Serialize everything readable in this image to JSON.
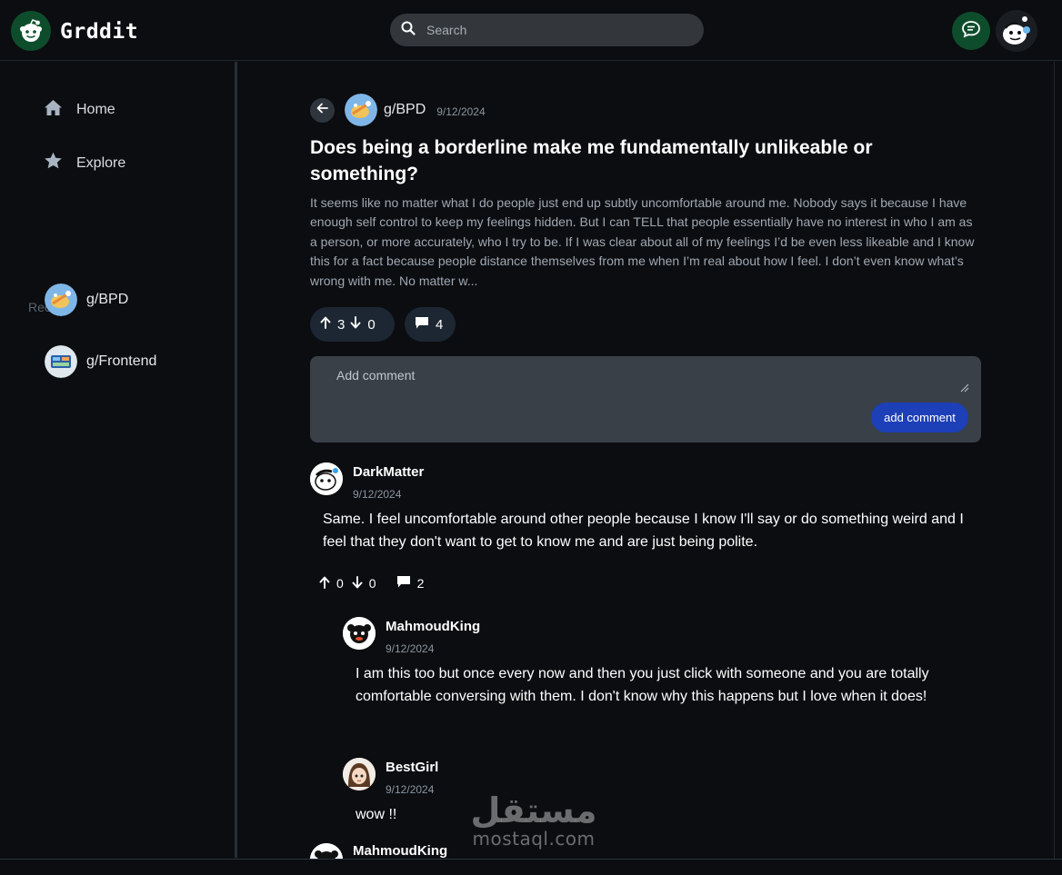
{
  "app": {
    "name": "Grddit",
    "brand_color": "#0e4d2c",
    "accent": "#1d3fb8"
  },
  "search": {
    "placeholder": "Search"
  },
  "sidebar": {
    "nav": [
      {
        "label": "Home",
        "icon": "home-icon"
      },
      {
        "label": "Explore",
        "icon": "star-icon"
      }
    ],
    "recent_label": "Recent",
    "recent": [
      {
        "label": "g/BPD"
      },
      {
        "label": "g/Frontend"
      }
    ]
  },
  "post": {
    "community": "g/BPD",
    "date": "9/12/2024",
    "title": "Does being a borderline make me fundamentally unlikeable or something?",
    "body": "It seems like no matter what I do people just end up subtly uncomfortable around me. Nobody says it because I have enough self control to keep my feelings hidden. But I can TELL that people essentially have no interest in who I am as a person, or more accurately, who I try to be. If I was clear about all of my feelings I’d be even less likeable and I know this for a fact because people distance themselves from me when I’m real about how I feel. I don’t even know what’s wrong with me. No matter w...",
    "upvotes": "3",
    "downvotes": "0",
    "comments": "4"
  },
  "comment_box": {
    "placeholder": "Add comment",
    "button": "add comment"
  },
  "comments": [
    {
      "user": "DarkMatter",
      "date": "9/12/2024",
      "text": "Same. I feel uncomfortable around other people because I know I'll say or do something weird and I feel that they don't want to get to know me and are just being polite.",
      "up": "0",
      "down": "0",
      "replies": "2"
    },
    {
      "user": "MahmoudKing",
      "date": "9/12/2024",
      "text": "I am this too but once every now and then you just click with someone and you are totally comfortable conversing with them. I don't know why this happens but I love when it does!"
    },
    {
      "user": "BestGirl",
      "date": "9/12/2024",
      "text": "wow !!"
    },
    {
      "user": "MahmoudKing"
    }
  ],
  "watermark": {
    "arabic": "مستقل",
    "latin": "mostaql.com"
  }
}
